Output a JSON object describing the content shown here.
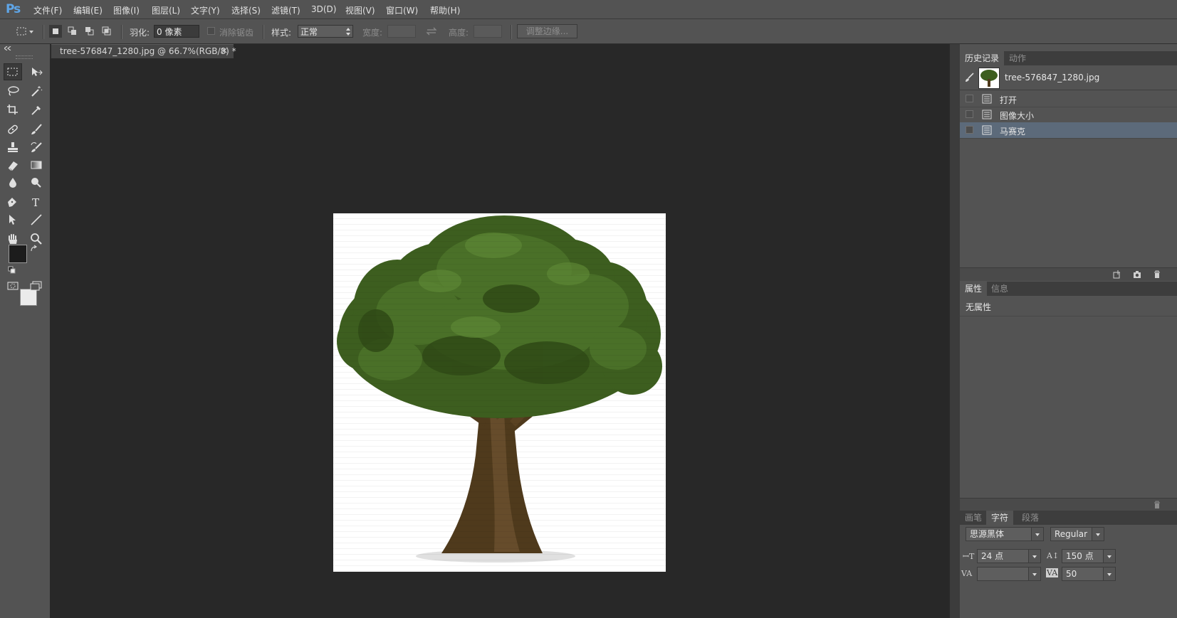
{
  "app": {
    "logo": "Ps"
  },
  "menu": [
    "文件(F)",
    "编辑(E)",
    "图像(I)",
    "图层(L)",
    "文字(Y)",
    "选择(S)",
    "滤镜(T)",
    "3D(D)",
    "视图(V)",
    "窗口(W)",
    "帮助(H)"
  ],
  "options": {
    "feather_label": "羽化:",
    "feather_value": "0 像素",
    "antialias_label": "消除锯齿",
    "style_label": "样式:",
    "style_value": "正常",
    "width_label": "宽度:",
    "height_label": "高度:",
    "refine_edge_label": "调整边缘..."
  },
  "document": {
    "tab_title": "tree-576847_1280.jpg @ 66.7%(RGB/8) *",
    "close_glyph": "×"
  },
  "colors": {
    "foreground": "#1c1c1c",
    "background": "#ebebeb",
    "selection_highlight": "#5c6a7a"
  },
  "history_panel": {
    "tabs": [
      "历史记录",
      "动作"
    ],
    "active_tab": "历史记录",
    "snapshot_name": "tree-576847_1280.jpg",
    "steps": [
      {
        "label": "打开",
        "selected": false
      },
      {
        "label": "图像大小",
        "selected": false
      },
      {
        "label": "马赛克",
        "selected": true
      }
    ]
  },
  "properties_panel": {
    "tabs": [
      "属性",
      "信息"
    ],
    "active_tab": "属性",
    "content": "无属性"
  },
  "character_panel": {
    "tabs": [
      "画笔",
      "字符",
      "段落"
    ],
    "active_tab": "字符",
    "font_family": "思源黑体",
    "font_style": "Regular",
    "font_size": "24 点",
    "leading": "150 点",
    "kerning": "",
    "tracking": "50"
  }
}
